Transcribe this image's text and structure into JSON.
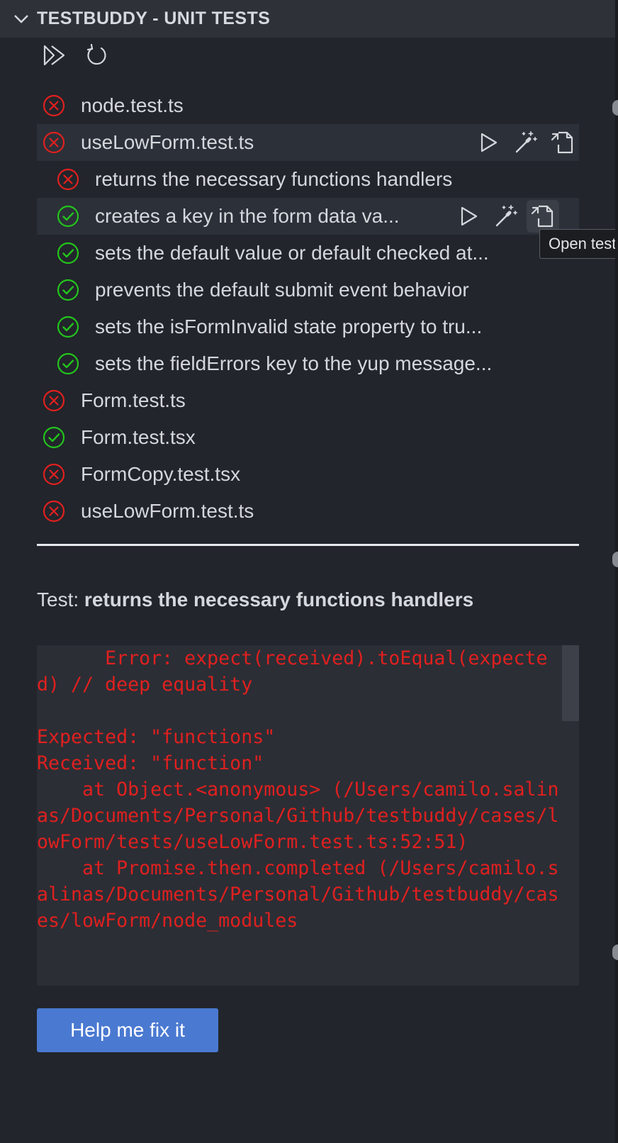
{
  "panel": {
    "title": "TESTBUDDY - UNIT TESTS",
    "toolbar": {
      "run_all_icon": "run-all-icon",
      "refresh_icon": "refresh-icon"
    }
  },
  "colors": {
    "fail": "#e0201f",
    "pass": "#23c41d",
    "accent_button": "#4a79d1"
  },
  "tree": [
    {
      "label": "node.test.ts",
      "status": "fail"
    },
    {
      "label": "useLowForm.test.ts",
      "status": "fail"
    },
    {
      "label": "returns the necessary functions handlers",
      "status": "fail"
    },
    {
      "label": "creates a key in the form data va...",
      "status": "pass"
    },
    {
      "label": "sets the default value or default checked at...",
      "status": "pass"
    },
    {
      "label": "prevents the default submit event behavior",
      "status": "pass"
    },
    {
      "label": "sets the isFormInvalid state property to tru...",
      "status": "pass"
    },
    {
      "label": "sets the fieldErrors key to the yup message...",
      "status": "pass"
    },
    {
      "label": "Form.test.ts",
      "status": "fail"
    },
    {
      "label": "Form.test.tsx",
      "status": "pass"
    },
    {
      "label": "FormCopy.test.tsx",
      "status": "fail"
    },
    {
      "label": "useLowForm.test.ts",
      "status": "fail"
    }
  ],
  "tooltip": {
    "text": "Open test"
  },
  "details": {
    "prefix": "Test: ",
    "name": "returns the necessary functions handlers",
    "error": "      Error: expect(received).toEqual(expected) // deep equality\n\nExpected: \"functions\"\nReceived: \"function\"\n    at Object.<anonymous> (/Users/camilo.salinas/Documents/Personal/Github/testbuddy/cases/lowForm/tests/useLowForm.test.ts:52:51)\n    at Promise.then.completed (/Users/camilo.salinas/Documents/Personal/Github/testbuddy/cases/lowForm/node_modules"
  },
  "fix_button": {
    "label": "Help me fix it"
  }
}
